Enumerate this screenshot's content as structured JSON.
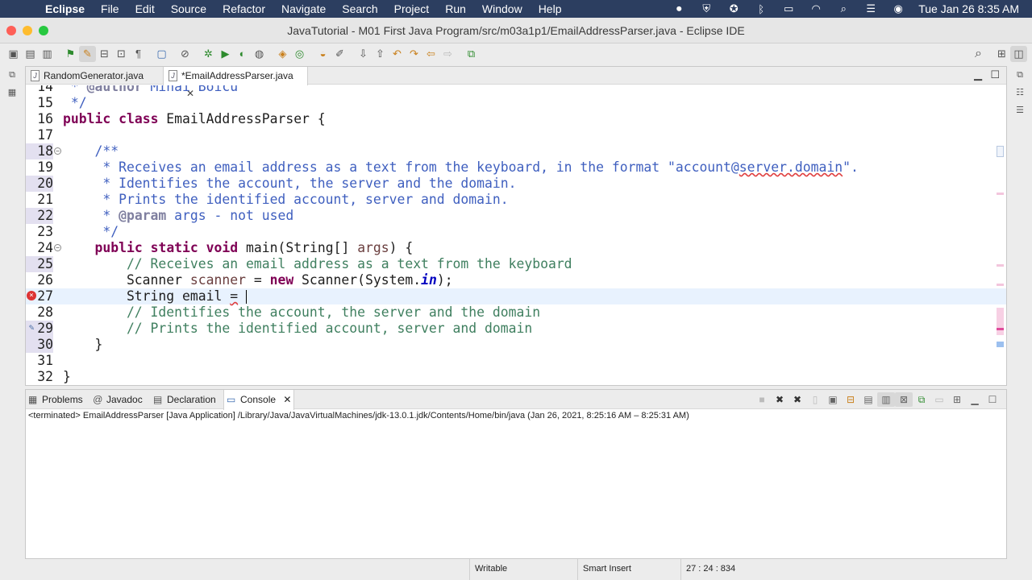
{
  "menubar": {
    "apple": "",
    "app_name": "Eclipse",
    "items": [
      "File",
      "Edit",
      "Source",
      "Refactor",
      "Navigate",
      "Search",
      "Project",
      "Run",
      "Window",
      "Help"
    ],
    "clock": "Tue Jan 26  8:35 AM",
    "bg_color": "#2c3e60"
  },
  "window": {
    "title": "JavaTutorial - M01 First Java Program/src/m03a1p1/EmailAddressParser.java - Eclipse IDE",
    "traffic_colors": [
      "#fe5f57",
      "#febc2e",
      "#28c840"
    ]
  },
  "editor": {
    "tabs": [
      {
        "label": "RandomGenerator.java",
        "active": false
      },
      {
        "label": "*EmailAddressParser.java",
        "active": true
      }
    ],
    "lines": [
      {
        "num": "14",
        "text": " * @author Mihai Boicu"
      },
      {
        "num": "15",
        "text": " */"
      },
      {
        "num": "16",
        "text": "public class EmailAddressParser {"
      },
      {
        "num": "17",
        "text": ""
      },
      {
        "num": "18",
        "text": "    /**"
      },
      {
        "num": "19",
        "text": "     * Receives an email address as a text from the keyboard, in the format \"account@server.domain\"."
      },
      {
        "num": "20",
        "text": "     * Identifies the account, the server and the domain."
      },
      {
        "num": "21",
        "text": "     * Prints the identified account, server and domain."
      },
      {
        "num": "22",
        "text": "     * @param args - not used"
      },
      {
        "num": "23",
        "text": "     */"
      },
      {
        "num": "24",
        "text": "    public static void main(String[] args) {"
      },
      {
        "num": "25",
        "text": "        // Receives an email address as a text from the keyboard"
      },
      {
        "num": "26",
        "text": "        Scanner scanner = new Scanner(System.in);"
      },
      {
        "num": "27",
        "text": "        String email = "
      },
      {
        "num": "28",
        "text": "        // Identifies the account, the server and the domain"
      },
      {
        "num": "29",
        "text": "        // Prints the identified account, server and domain"
      },
      {
        "num": "30",
        "text": "    }"
      },
      {
        "num": "31",
        "text": ""
      },
      {
        "num": "32",
        "text": "}"
      }
    ]
  },
  "console": {
    "tabs": [
      {
        "label": "Problems",
        "icon": "problems-icon",
        "active": false
      },
      {
        "label": "Javadoc",
        "icon": "javadoc-icon",
        "active": false
      },
      {
        "label": "Declaration",
        "icon": "declaration-icon",
        "active": false
      },
      {
        "label": "Console",
        "icon": "console-icon",
        "active": true
      }
    ],
    "status": "<terminated> EmailAddressParser [Java Application] /Library/Java/JavaVirtualMachines/jdk-13.0.1.jdk/Contents/Home/bin/java  (Jan 26, 2021, 8:25:16 AM – 8:25:31 AM)"
  },
  "statusbar": {
    "mode": "Writable",
    "insert": "Smart Insert",
    "position": "27 : 24 : 834"
  }
}
